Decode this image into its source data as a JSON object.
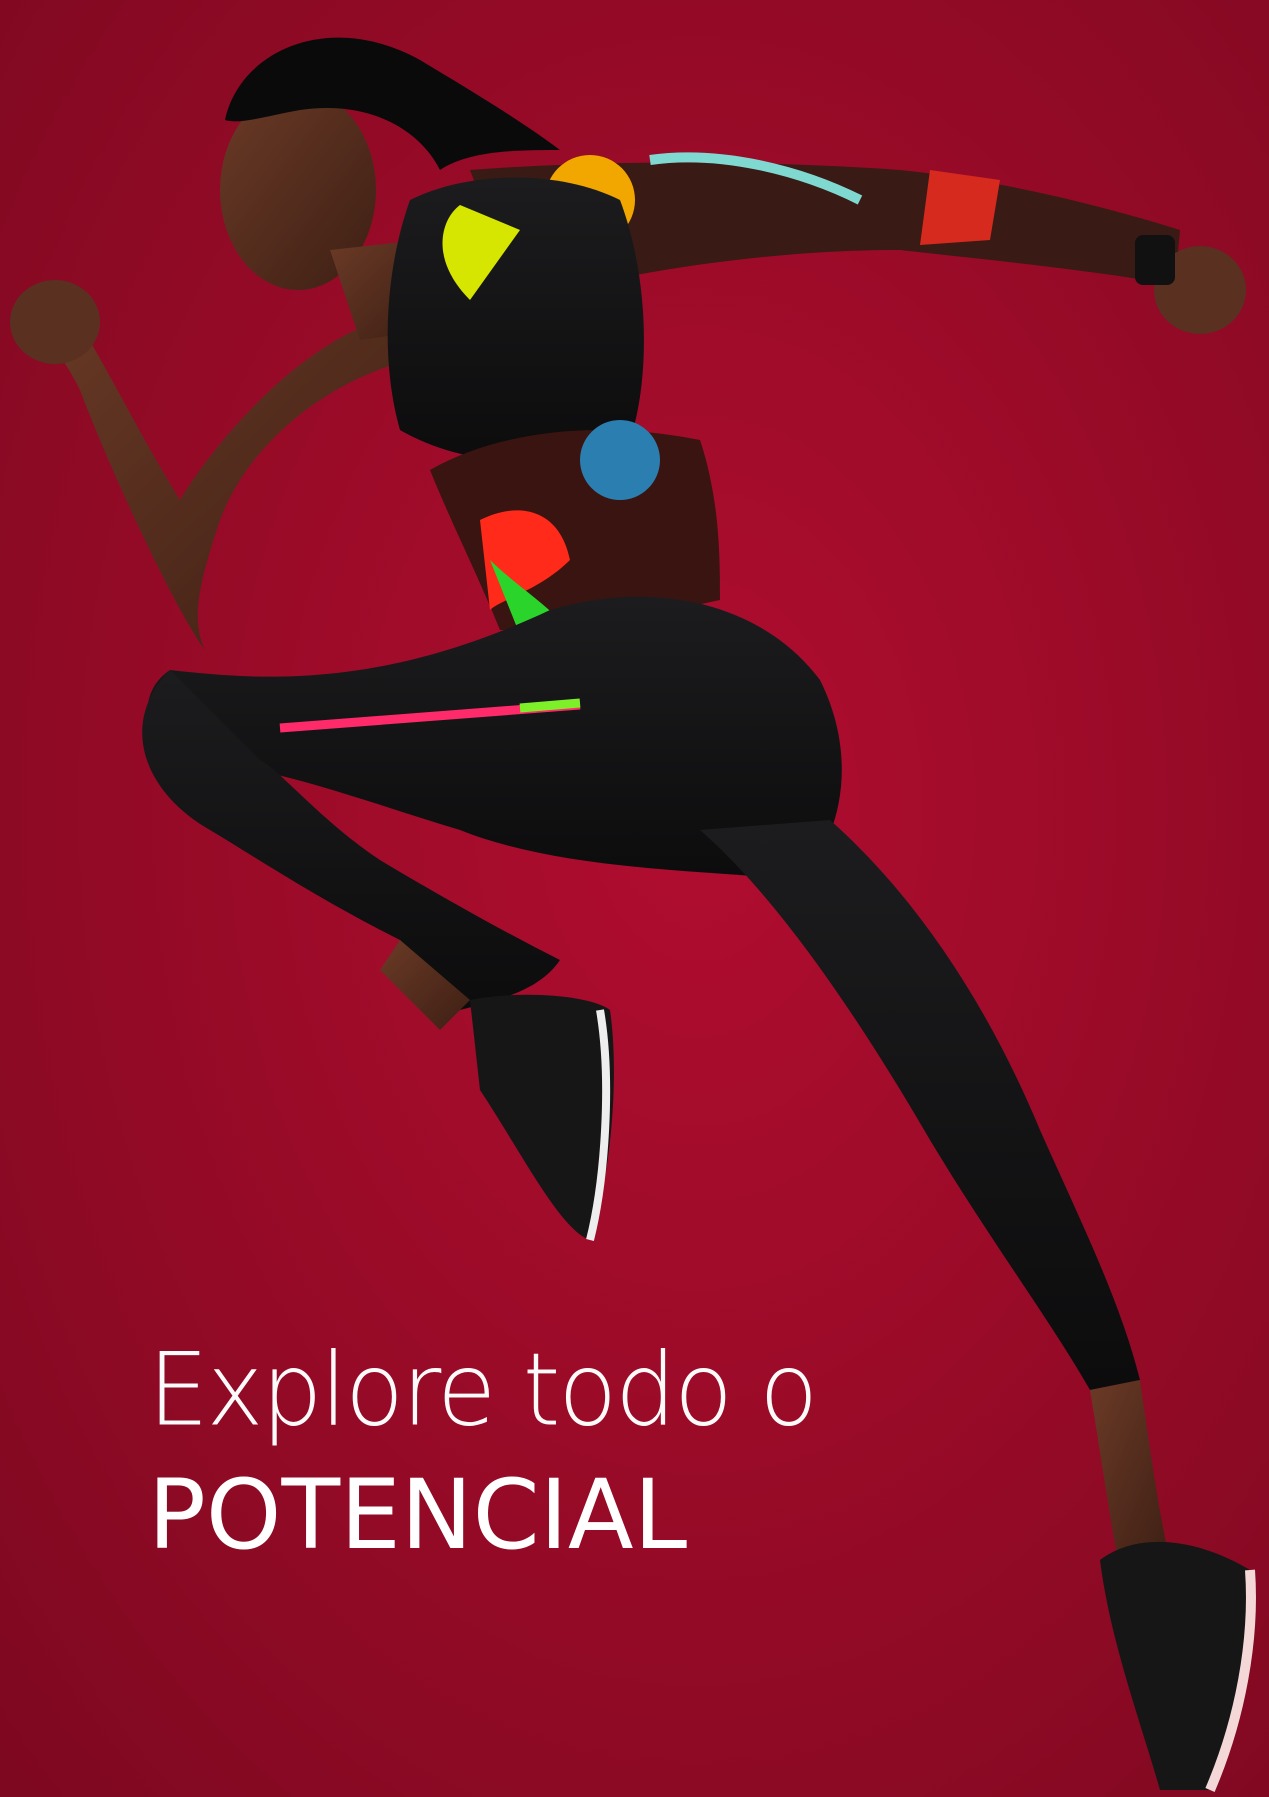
{
  "hero": {
    "image": "athlete-sprinting",
    "background_color": "#a00a2a"
  },
  "headline": {
    "line1": "Explore todo o",
    "line2": "POTENCIAL"
  }
}
